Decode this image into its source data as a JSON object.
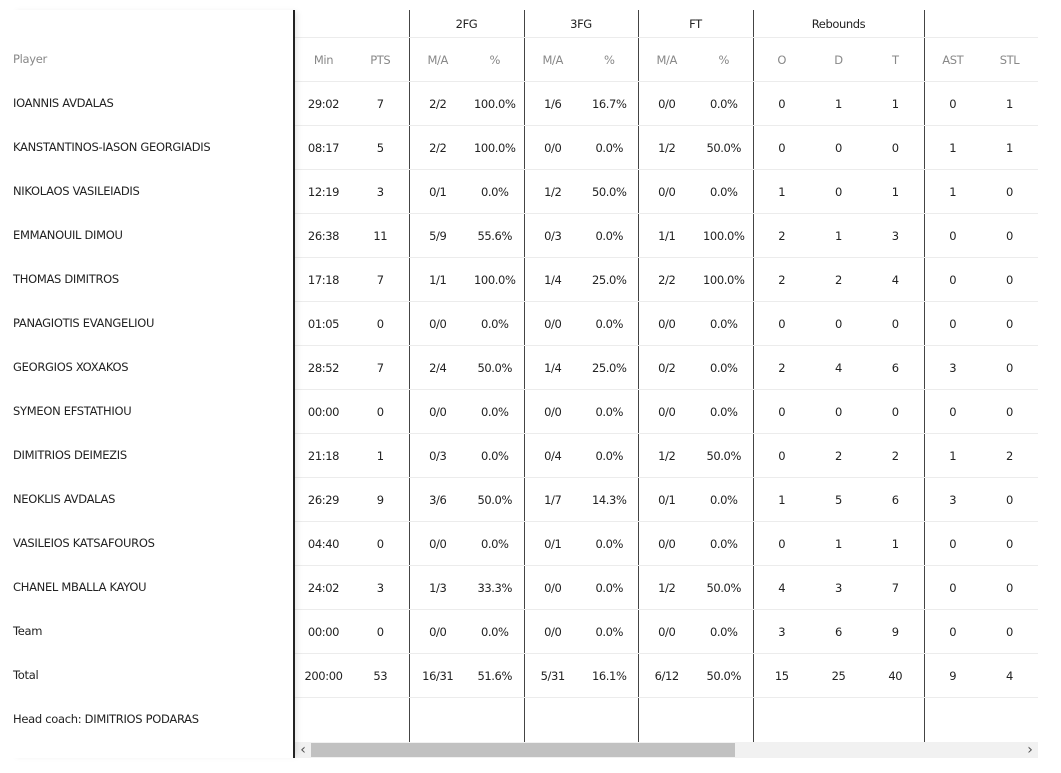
{
  "header": {
    "groups": [
      "2FG",
      "3FG",
      "FT",
      "Rebounds"
    ],
    "player_label": "Player",
    "columns": [
      "Min",
      "PTS",
      "M/A",
      "%",
      "M/A",
      "%",
      "M/A",
      "%",
      "O",
      "D",
      "T",
      "AST",
      "STL"
    ]
  },
  "rows": [
    {
      "name": "IOANNIS AVDALAS",
      "stats": [
        "29:02",
        "7",
        "2/2",
        "100.0%",
        "1/6",
        "16.7%",
        "0/0",
        "0.0%",
        "0",
        "1",
        "1",
        "0",
        "1"
      ]
    },
    {
      "name": "KANSTANTINOS-IASON GEORGIADIS",
      "stats": [
        "08:17",
        "5",
        "2/2",
        "100.0%",
        "0/0",
        "0.0%",
        "1/2",
        "50.0%",
        "0",
        "0",
        "0",
        "1",
        "1"
      ]
    },
    {
      "name": "NIKOLAOS VASILEIADIS",
      "stats": [
        "12:19",
        "3",
        "0/1",
        "0.0%",
        "1/2",
        "50.0%",
        "0/0",
        "0.0%",
        "1",
        "0",
        "1",
        "1",
        "0"
      ]
    },
    {
      "name": "EMMANOUIL DIMOU",
      "stats": [
        "26:38",
        "11",
        "5/9",
        "55.6%",
        "0/3",
        "0.0%",
        "1/1",
        "100.0%",
        "2",
        "1",
        "3",
        "0",
        "0"
      ]
    },
    {
      "name": "THOMAS DIMITROS",
      "stats": [
        "17:18",
        "7",
        "1/1",
        "100.0%",
        "1/4",
        "25.0%",
        "2/2",
        "100.0%",
        "2",
        "2",
        "4",
        "0",
        "0"
      ]
    },
    {
      "name": "PANAGIOTIS EVANGELIOU",
      "stats": [
        "01:05",
        "0",
        "0/0",
        "0.0%",
        "0/0",
        "0.0%",
        "0/0",
        "0.0%",
        "0",
        "0",
        "0",
        "0",
        "0"
      ]
    },
    {
      "name": "GEORGIOS XOXAKOS",
      "stats": [
        "28:52",
        "7",
        "2/4",
        "50.0%",
        "1/4",
        "25.0%",
        "0/2",
        "0.0%",
        "2",
        "4",
        "6",
        "3",
        "0"
      ]
    },
    {
      "name": "SYMEON EFSTATHIOU",
      "stats": [
        "00:00",
        "0",
        "0/0",
        "0.0%",
        "0/0",
        "0.0%",
        "0/0",
        "0.0%",
        "0",
        "0",
        "0",
        "0",
        "0"
      ]
    },
    {
      "name": "DIMITRIOS DEIMEZIS",
      "stats": [
        "21:18",
        "1",
        "0/3",
        "0.0%",
        "0/4",
        "0.0%",
        "1/2",
        "50.0%",
        "0",
        "2",
        "2",
        "1",
        "2"
      ]
    },
    {
      "name": "NEOKLIS AVDALAS",
      "stats": [
        "26:29",
        "9",
        "3/6",
        "50.0%",
        "1/7",
        "14.3%",
        "0/1",
        "0.0%",
        "1",
        "5",
        "6",
        "3",
        "0"
      ]
    },
    {
      "name": "VASILEIOS KATSAFOUROS",
      "stats": [
        "04:40",
        "0",
        "0/0",
        "0.0%",
        "0/1",
        "0.0%",
        "0/0",
        "0.0%",
        "0",
        "1",
        "1",
        "0",
        "0"
      ]
    },
    {
      "name": "CHANEL MBALLA KAYOU",
      "stats": [
        "24:02",
        "3",
        "1/3",
        "33.3%",
        "0/0",
        "0.0%",
        "1/2",
        "50.0%",
        "4",
        "3",
        "7",
        "0",
        "0"
      ]
    },
    {
      "name": "Team",
      "stats": [
        "00:00",
        "0",
        "0/0",
        "0.0%",
        "0/0",
        "0.0%",
        "0/0",
        "0.0%",
        "3",
        "6",
        "9",
        "0",
        "0"
      ]
    },
    {
      "name": "Total",
      "stats": [
        "200:00",
        "53",
        "16/31",
        "51.6%",
        "5/31",
        "16.1%",
        "6/12",
        "50.0%",
        "15",
        "25",
        "40",
        "9",
        "4"
      ]
    }
  ],
  "coach": "Head coach: DIMITRIOS PODARAS",
  "scrollbar": {
    "left_arrow": "‹",
    "right_arrow": "›"
  }
}
